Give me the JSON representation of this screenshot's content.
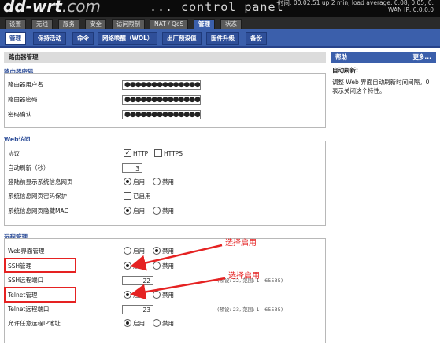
{
  "header": {
    "logo": "dd-wrt",
    "logo_suffix": ".com",
    "control_panel": "... control panel",
    "status_line1": "时间: 00:02:51 up 2 min, load average: 0.08, 0.05, 0.",
    "status_line2": "WAN IP: 0.0.0.0"
  },
  "main_tabs": [
    "设置",
    "无线",
    "服务",
    "安全",
    "访问限制",
    "NAT / QoS",
    "管理",
    "状态"
  ],
  "sub_tabs": [
    "管理",
    "保持活动",
    "命令",
    "网络唤醒（WOL）",
    "出厂预设值",
    "固件升级",
    "备份"
  ],
  "main": {
    "title": "路由器管理",
    "router_password": {
      "title": "路由器密码",
      "username_label": "路由器用户名",
      "username_value": "●●●●●●●●●●●●●●●●●",
      "password_label": "路由器密码",
      "password_value": "●●●●●●●●●●●●●●●●●",
      "confirm_label": "密码确认",
      "confirm_value": "●●●●●●●●●●●●●●●●●"
    },
    "web_access": {
      "title": "Web访问",
      "protocol_label": "协议",
      "http_label": "HTTP",
      "https_label": "HTTPS",
      "auto_refresh_label": "自动刷新（秒）",
      "auto_refresh_value": "3",
      "login_info_label": "登陆前显示系统信息网页",
      "info_pw_label": "系统信息网页密码保护",
      "info_pw_option": "已启用",
      "hide_mac_label": "系统信息网页隐藏MAC"
    },
    "remote": {
      "title": "远程管理",
      "web_mgmt_label": "Web界面管理",
      "ssh_mgmt_label": "SSH管理",
      "ssh_port_label": "SSH远程端口",
      "ssh_port_value": "22",
      "ssh_port_hint": "(预设: 22, 范围: 1 - 65535)",
      "telnet_mgmt_label": "Telnet管理",
      "telnet_port_label": "Telnet远程端口",
      "telnet_port_value": "23",
      "telnet_port_hint": "(预设: 23, 范围: 1 - 65535)",
      "any_ip_label": "允许任意远程IP地址"
    },
    "enable": "启用",
    "disable": "禁用"
  },
  "help": {
    "title": "帮助",
    "more": "更多...",
    "subtitle": "自动刷新:",
    "text": "调整 Web 界面自动刷新时间间隔。0 表示关闭这个特性。"
  },
  "annotations": {
    "select_enable_1": "选择启用",
    "select_enable_2": "选择启用",
    "color": "#e52222"
  },
  "colors": {
    "tab_blue": "#3b5fab",
    "header_black": "#0b0b0b"
  }
}
